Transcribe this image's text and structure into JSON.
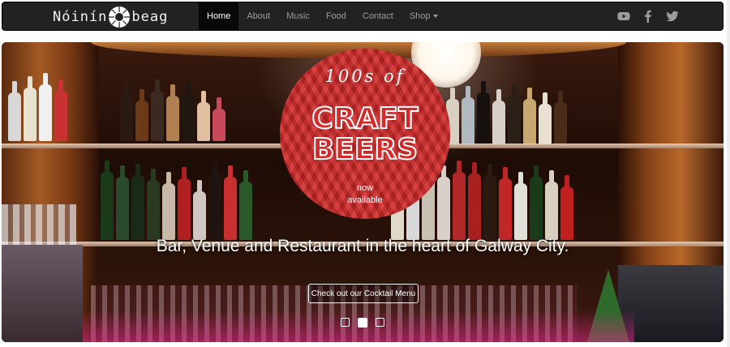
{
  "navbar": {
    "brand_left": "Nóinín",
    "brand_right": "beag",
    "items": [
      {
        "label": "Home",
        "active": true
      },
      {
        "label": "About",
        "active": false
      },
      {
        "label": "Music",
        "active": false
      },
      {
        "label": "Food",
        "active": false
      },
      {
        "label": "Contact",
        "active": false
      },
      {
        "label": "Shop",
        "active": false,
        "dropdown": true
      }
    ],
    "socials": [
      "youtube-icon",
      "facebook-icon",
      "twitter-icon"
    ],
    "colors": {
      "bar": "#222222",
      "active": "#080808",
      "link": "#9d9d9d"
    }
  },
  "hero": {
    "badge": {
      "top_text": "100s of",
      "line1": "CRAFT",
      "line2": "BEERS",
      "sub1": "now",
      "sub2": "available",
      "color": "#d42a2a"
    },
    "caption": "Bar, Venue and Restaurant in the heart of Galway City.",
    "cta_label": "Check out our Cocktail Menu",
    "slide_count": 3,
    "active_slide": 2
  }
}
